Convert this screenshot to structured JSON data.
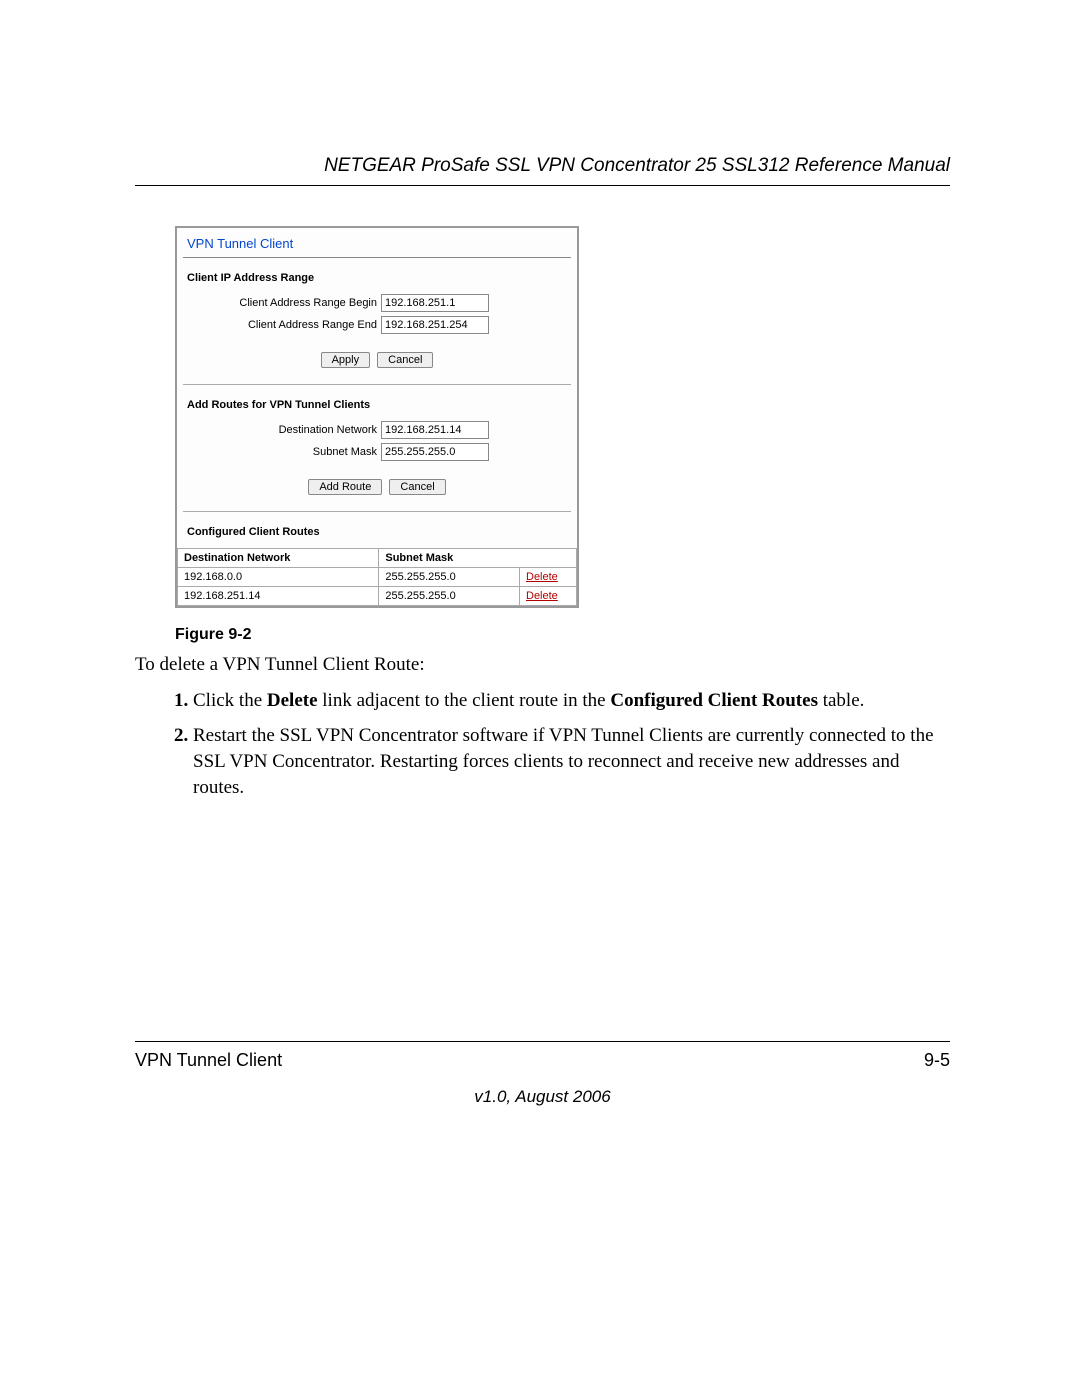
{
  "header": {
    "title": "NETGEAR ProSafe SSL VPN Concentrator 25 SSL312 Reference Manual"
  },
  "panel": {
    "title": "VPN Tunnel Client",
    "range": {
      "heading": "Client IP Address Range",
      "begin_label": "Client Address Range Begin",
      "begin_value": "192.168.251.1",
      "end_label": "Client Address Range End",
      "end_value": "192.168.251.254",
      "apply": "Apply",
      "cancel": "Cancel"
    },
    "add_routes": {
      "heading": "Add Routes for VPN Tunnel Clients",
      "dest_label": "Destination Network",
      "dest_value": "192.168.251.14",
      "mask_label": "Subnet Mask",
      "mask_value": "255.255.255.0",
      "add": "Add Route",
      "cancel": "Cancel"
    },
    "routes_table": {
      "heading": "Configured Client Routes",
      "col_dest": "Destination Network",
      "col_mask": "Subnet Mask",
      "delete_label": "Delete",
      "rows": [
        {
          "dest": "192.168.0.0",
          "mask": "255.255.255.0"
        },
        {
          "dest": "192.168.251.14",
          "mask": "255.255.255.0"
        }
      ]
    }
  },
  "figure_caption": "Figure 9-2",
  "intro": "To delete a VPN Tunnel Client Route:",
  "steps": {
    "s1_a": "Click the ",
    "s1_b": "Delete",
    "s1_c": " link adjacent to the client route in the ",
    "s1_d": "Configured Client Routes",
    "s1_e": " table.",
    "s2": "Restart the SSL VPN Concentrator software if VPN Tunnel Clients are currently connected to the SSL VPN Concentrator. Restarting forces clients to reconnect and receive new addresses and routes."
  },
  "footer": {
    "left": "VPN Tunnel Client",
    "right": "9-5",
    "version": "v1.0, August 2006"
  }
}
